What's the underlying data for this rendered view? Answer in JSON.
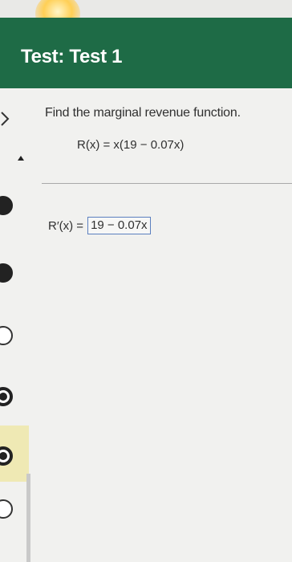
{
  "header": {
    "title": "Test: Test 1"
  },
  "sidebar": {
    "items": [
      {
        "state": "filled"
      },
      {
        "state": "filled"
      },
      {
        "state": "hollow"
      },
      {
        "state": "ring"
      },
      {
        "state": "ring"
      },
      {
        "state": "hollow"
      }
    ],
    "highlight_color": "#efe9b4"
  },
  "question": {
    "prompt": "Find the marginal revenue function.",
    "function": "R(x) = x(19 − 0.07x)"
  },
  "answer": {
    "label": "R′(x) =",
    "value": "19 − 0.07x"
  },
  "colors": {
    "header_bg": "#1e6b46",
    "input_border": "#5b7fbf"
  }
}
